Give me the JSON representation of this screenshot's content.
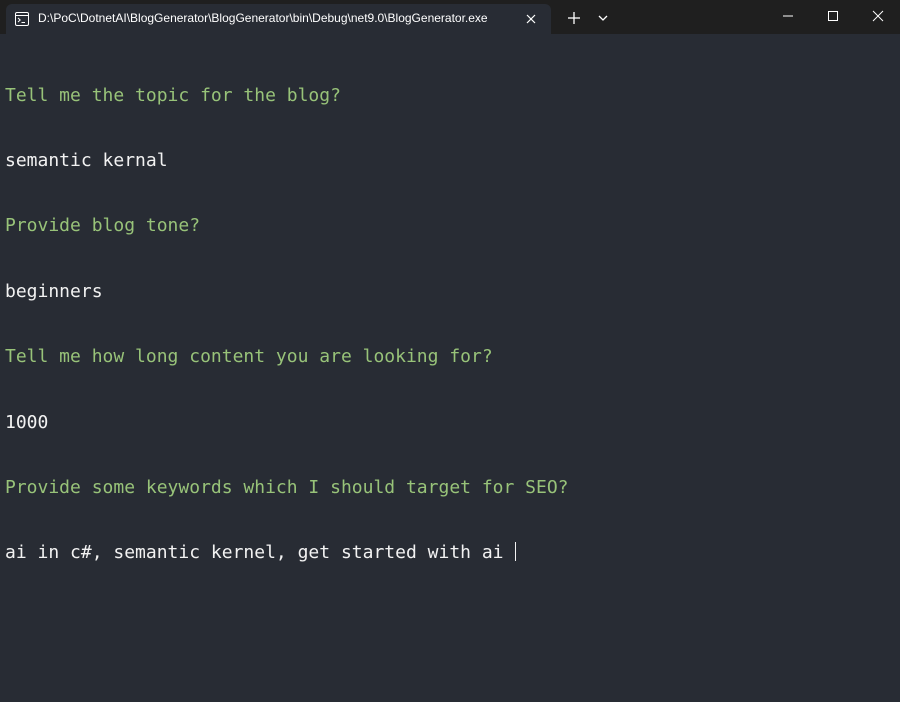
{
  "window": {
    "tab_title": "D:\\PoC\\DotnetAI\\BlogGenerator\\BlogGenerator\\bin\\Debug\\net9.0\\BlogGenerator.exe",
    "tab_icon": "terminal-icon",
    "controls": [
      "new-tab-icon",
      "chevron-down-icon",
      "minimize-icon",
      "maximize-icon",
      "close-icon"
    ]
  },
  "colors": {
    "background": "#282c34",
    "titlebar": "#1f1f1f",
    "prompt": "#98c379",
    "answer": "#f2f2f2"
  },
  "terminal": {
    "lines": [
      {
        "kind": "prompt",
        "text": "Tell me the topic for the blog?"
      },
      {
        "kind": "answer",
        "text": "semantic kernal"
      },
      {
        "kind": "prompt",
        "text": "Provide blog tone?"
      },
      {
        "kind": "answer",
        "text": "beginners"
      },
      {
        "kind": "prompt",
        "text": "Tell me how long content you are looking for?"
      },
      {
        "kind": "answer",
        "text": "1000"
      },
      {
        "kind": "prompt",
        "text": "Provide some keywords which I should target for SEO?"
      },
      {
        "kind": "answer",
        "text": "ai in c#, semantic kernel, get started with ai "
      }
    ]
  }
}
